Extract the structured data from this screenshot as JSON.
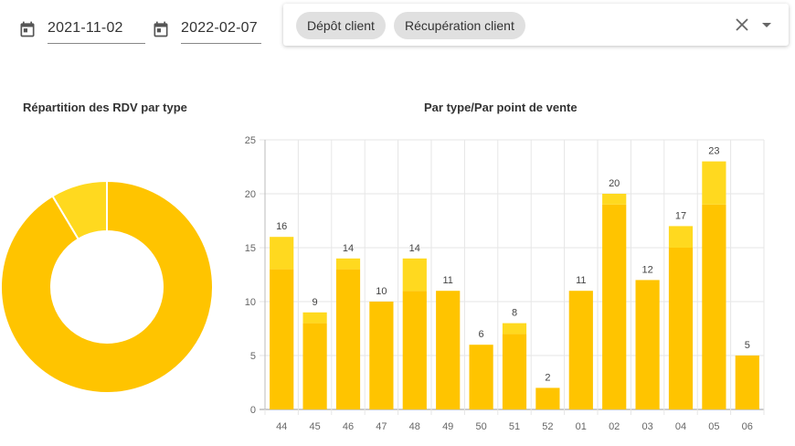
{
  "filters": {
    "start_date": "2021-11-02",
    "end_date": "2022-02-07",
    "chips": [
      "Dépôt client",
      "Récupération client"
    ]
  },
  "colors": {
    "primary": "#ffc400",
    "secondary": "#ffd91f",
    "chip_bg": "#e0e0e0"
  },
  "chart_data": [
    {
      "type": "pie",
      "title": "Répartition des RDV par type",
      "values": [
        181,
        17
      ],
      "colors": [
        "#ffc400",
        "#ffd91f"
      ],
      "donut": true
    },
    {
      "type": "bar",
      "stacked": true,
      "title": "Par type/Par point de vente",
      "categories": [
        "44",
        "45",
        "46",
        "47",
        "48",
        "49",
        "50",
        "51",
        "52",
        "01",
        "02",
        "03",
        "04",
        "05",
        "06"
      ],
      "series": [
        {
          "values": [
            13,
            8,
            13,
            10,
            11,
            11,
            6,
            7,
            2,
            11,
            19,
            12,
            15,
            19,
            5
          ],
          "color": "#ffc400"
        },
        {
          "values": [
            3,
            1,
            1,
            0,
            3,
            0,
            0,
            1,
            0,
            0,
            1,
            0,
            2,
            4,
            0
          ],
          "color": "#ffd91f"
        }
      ],
      "totals": [
        "16",
        "9",
        "14",
        "10",
        "14",
        "11",
        "6",
        "8",
        "2",
        "11",
        "20",
        "12",
        "17",
        "23",
        "5"
      ],
      "yticks": [
        "0",
        "5",
        "10",
        "15",
        "20",
        "25"
      ],
      "ylim": [
        0,
        25
      ],
      "grid": true
    }
  ]
}
